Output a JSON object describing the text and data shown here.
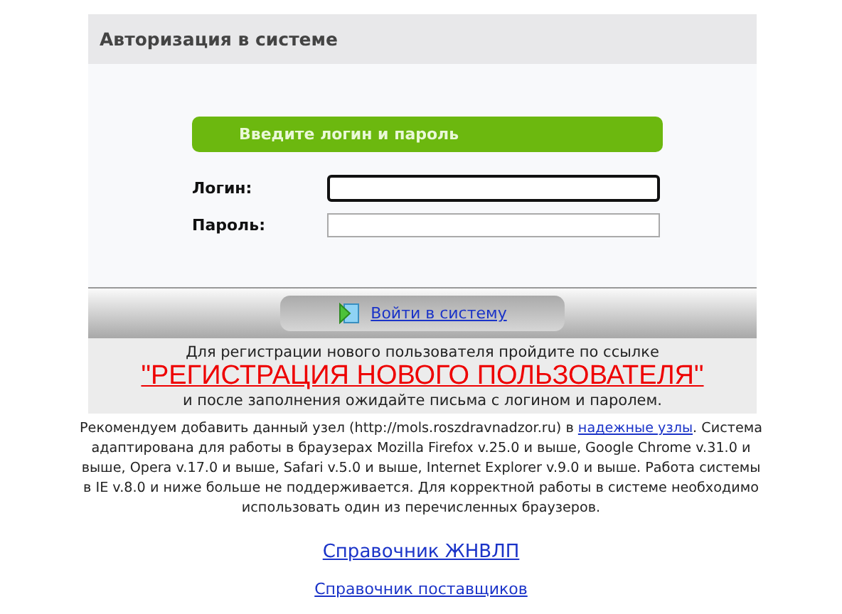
{
  "panel": {
    "title": "Авторизация в системе"
  },
  "form": {
    "banner": "Введите логин и пароль",
    "fields": [
      {
        "label": "Логин:",
        "focused": true
      },
      {
        "label": "Пароль:",
        "focused": false
      }
    ],
    "submit": "Войти в систему"
  },
  "registration": {
    "intro": "Для регистрации нового пользователя пройдите по ссылке",
    "link": "\"РЕГИСТРАЦИЯ НОВОГО ПОЛЬЗОВАТЕЛЯ\"",
    "outro": "и после заполнения ожидайте письма с логином и паролем."
  },
  "notice": {
    "before": "Рекомендуем добавить данный узел (http://mols.roszdravnadzor.ru) в ",
    "link": "надежные узлы",
    "after": ". Система адаптирована для работы в браузерах Mozilla Firefox v.25.0 и выше, Google Chrome v.31.0 и выше, Opera v.17.0 и выше, Safari v.5.0 и выше, Internet Explorer v.9.0 и выше. Работа системы в IE v.8.0 и ниже больше не поддерживается. Для корректной работы в системе необходимо использовать один из перечисленных браузеров."
  },
  "links": [
    {
      "label": "Справочник ЖНВЛП",
      "kind": "large"
    },
    {
      "label": "Справочник поставщиков",
      "kind": "small"
    }
  ]
}
